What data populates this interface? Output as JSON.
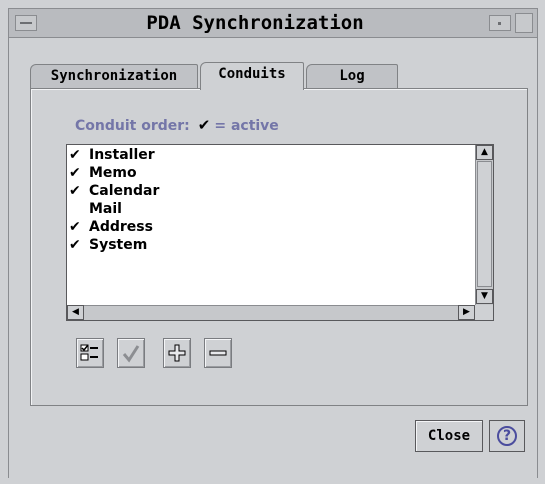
{
  "window": {
    "title": "PDA Synchronization"
  },
  "tabs": [
    {
      "label": "Synchronization",
      "active": false
    },
    {
      "label": "Conduits",
      "active": true
    },
    {
      "label": "Log",
      "active": false
    }
  ],
  "conduits": {
    "order_label": "Conduit order:",
    "legend_mark": "✔",
    "legend_text": "= active",
    "items": [
      {
        "label": "Installer",
        "active": true,
        "mark": "✔"
      },
      {
        "label": "Memo",
        "active": true,
        "mark": "✔"
      },
      {
        "label": "Calendar",
        "active": true,
        "mark": "✔"
      },
      {
        "label": "Mail",
        "active": false,
        "mark": ""
      },
      {
        "label": "Address",
        "active": true,
        "mark": "✔"
      },
      {
        "label": "System",
        "active": true,
        "mark": "✔"
      }
    ]
  },
  "toolbar": {
    "buttons": [
      {
        "icon": "checklist-icon"
      },
      {
        "icon": "check-icon"
      },
      {
        "icon": "plus-icon"
      },
      {
        "icon": "minus-icon"
      }
    ]
  },
  "footer": {
    "close_label": "Close",
    "help_glyph": "?"
  }
}
